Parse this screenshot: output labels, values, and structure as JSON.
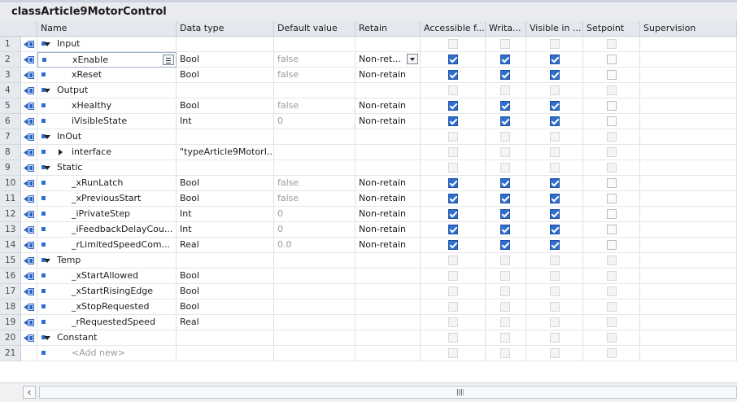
{
  "title": "classArticle9MotorControl",
  "columns": {
    "name": "Name",
    "datatype": "Data type",
    "default": "Default value",
    "retain": "Retain",
    "accessible": "Accessible f...",
    "writable": "Writa...",
    "visible": "Visible in ...",
    "setpoint": "Setpoint",
    "supervision": "Supervision"
  },
  "rows": [
    {
      "num": "1",
      "kind": "section",
      "name": "Input",
      "datatype": "",
      "default": "",
      "retain": "",
      "checks": [
        "dis",
        "dis",
        "dis",
        "dis"
      ]
    },
    {
      "num": "2",
      "kind": "var",
      "name": "xEnable",
      "datatype": "Bool",
      "default": "false",
      "retain": "Non-ret...",
      "checks": [
        "on",
        "on",
        "on",
        "off"
      ],
      "selected": true
    },
    {
      "num": "3",
      "kind": "var",
      "name": "xReset",
      "datatype": "Bool",
      "default": "false",
      "retain": "Non-retain",
      "checks": [
        "on",
        "on",
        "on",
        "off"
      ]
    },
    {
      "num": "4",
      "kind": "section",
      "name": "Output",
      "datatype": "",
      "default": "",
      "retain": "",
      "checks": [
        "dis",
        "dis",
        "dis",
        "dis"
      ]
    },
    {
      "num": "5",
      "kind": "var",
      "name": "xHealthy",
      "datatype": "Bool",
      "default": "false",
      "retain": "Non-retain",
      "checks": [
        "on",
        "on",
        "on",
        "off"
      ]
    },
    {
      "num": "6",
      "kind": "var",
      "name": "iVisibleState",
      "datatype": "Int",
      "default": "0",
      "retain": "Non-retain",
      "checks": [
        "on",
        "on",
        "on",
        "off"
      ]
    },
    {
      "num": "7",
      "kind": "section",
      "name": "InOut",
      "datatype": "",
      "default": "",
      "retain": "",
      "checks": [
        "dis",
        "dis",
        "dis",
        "dis"
      ]
    },
    {
      "num": "8",
      "kind": "expandable",
      "name": "interface",
      "datatype": "\"typeArticle9MotorI...",
      "default": "",
      "retain": "",
      "checks": [
        "dis",
        "dis",
        "dis",
        "dis"
      ]
    },
    {
      "num": "9",
      "kind": "section",
      "name": "Static",
      "datatype": "",
      "default": "",
      "retain": "",
      "checks": [
        "dis",
        "dis",
        "dis",
        "dis"
      ]
    },
    {
      "num": "10",
      "kind": "var",
      "name": "_xRunLatch",
      "datatype": "Bool",
      "default": "false",
      "retain": "Non-retain",
      "checks": [
        "on",
        "on",
        "on",
        "off"
      ]
    },
    {
      "num": "11",
      "kind": "var",
      "name": "_xPreviousStart",
      "datatype": "Bool",
      "default": "false",
      "retain": "Non-retain",
      "checks": [
        "on",
        "on",
        "on",
        "off"
      ]
    },
    {
      "num": "12",
      "kind": "var",
      "name": "_iPrivateStep",
      "datatype": "Int",
      "default": "0",
      "retain": "Non-retain",
      "checks": [
        "on",
        "on",
        "on",
        "off"
      ]
    },
    {
      "num": "13",
      "kind": "var",
      "name": "_iFeedbackDelayCou...",
      "datatype": "Int",
      "default": "0",
      "retain": "Non-retain",
      "checks": [
        "on",
        "on",
        "on",
        "off"
      ]
    },
    {
      "num": "14",
      "kind": "var",
      "name": "_rLimitedSpeedCom...",
      "datatype": "Real",
      "default": "0.0",
      "retain": "Non-retain",
      "checks": [
        "on",
        "on",
        "on",
        "off"
      ]
    },
    {
      "num": "15",
      "kind": "section",
      "name": "Temp",
      "datatype": "",
      "default": "",
      "retain": "",
      "checks": [
        "dis",
        "dis",
        "dis",
        "dis"
      ]
    },
    {
      "num": "16",
      "kind": "var",
      "name": "_xStartAllowed",
      "datatype": "Bool",
      "default": "",
      "retain": "",
      "checks": [
        "dis",
        "dis",
        "dis",
        "dis"
      ]
    },
    {
      "num": "17",
      "kind": "var",
      "name": "_xStartRisingEdge",
      "datatype": "Bool",
      "default": "",
      "retain": "",
      "checks": [
        "dis",
        "dis",
        "dis",
        "dis"
      ]
    },
    {
      "num": "18",
      "kind": "var",
      "name": "_xStopRequested",
      "datatype": "Bool",
      "default": "",
      "retain": "",
      "checks": [
        "dis",
        "dis",
        "dis",
        "dis"
      ]
    },
    {
      "num": "19",
      "kind": "var",
      "name": "_rRequestedSpeed",
      "datatype": "Real",
      "default": "",
      "retain": "",
      "checks": [
        "dis",
        "dis",
        "dis",
        "dis"
      ]
    },
    {
      "num": "20",
      "kind": "section",
      "name": "Constant",
      "datatype": "",
      "default": "",
      "retain": "",
      "checks": [
        "dis",
        "dis",
        "dis",
        "dis"
      ]
    },
    {
      "num": "21",
      "kind": "add",
      "name": "<Add new>",
      "datatype": "",
      "default": "",
      "retain": "",
      "checks": [
        "dis",
        "dis",
        "dis",
        "dis"
      ]
    }
  ],
  "icons": {
    "interface": "interface-parameter-icon",
    "collapse": "collapse-arrow-icon",
    "expand": "expand-arrow-icon",
    "scroll_left": "scroll-left-arrow-icon"
  },
  "colors": {
    "checkbox_checked": "#2e6fd0",
    "header_bg": "#e4e8ee",
    "row_marker": "#2f6ed1"
  }
}
